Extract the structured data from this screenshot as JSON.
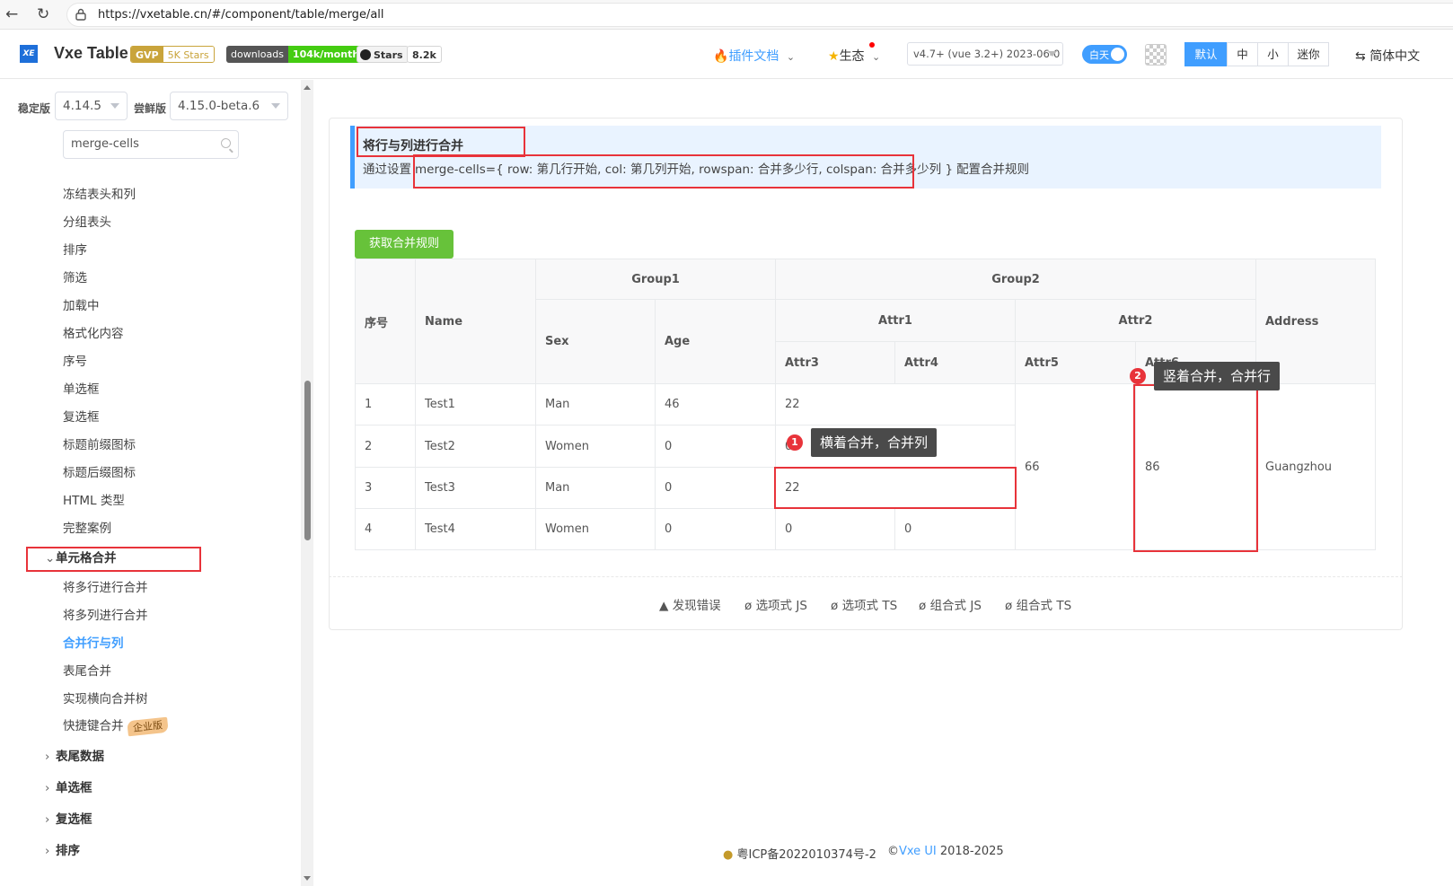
{
  "browser": {
    "url": "https://vxetable.cn/#/component/table/merge/all"
  },
  "header": {
    "logo": "XE",
    "brand": "Vxe Table",
    "badges": {
      "gvp": "GVP",
      "stars5k": "5K Stars",
      "downloads_label": "downloads",
      "downloads_value": "104k/month",
      "gh_stars_label": "Stars",
      "gh_stars_value": "8.2k"
    },
    "plugin_docs": "插件文档",
    "ecosystem": "生态",
    "version": "v4.7+ (vue 3.2+) 2023-06-0",
    "theme_toggle": "白天",
    "sizes": [
      "默认",
      "中",
      "小",
      "迷你"
    ],
    "language": "简体中文",
    "accent": "#409eff"
  },
  "sidebar": {
    "stable_label": "稳定版",
    "stable_value": "4.14.5",
    "beta_label": "尝鲜版",
    "beta_value": "4.15.0-beta.6",
    "search_value": "merge-cells",
    "items_top": [
      "冻结表头和列",
      "分组表头",
      "排序",
      "筛选",
      "加载中",
      "格式化内容",
      "序号",
      "单选框",
      "复选框",
      "标题前缀图标",
      "标题后缀图标",
      "HTML 类型",
      "完整案例"
    ],
    "group_open": "单元格合并",
    "sub_items": [
      "将多行进行合并",
      "将多列进行合并",
      "合并行与列",
      "表尾合并",
      "实现横向合并树",
      "快捷键合并"
    ],
    "enterprise_tag": "企业版",
    "groups_collapsed": [
      "表尾数据",
      "单选框",
      "复选框",
      "排序"
    ]
  },
  "demo": {
    "title": "将行与列进行合并",
    "desc_prefix": "通过设置",
    "desc_code": "merge-cells={ row: 第几行开始, col: 第几列开始, rowspan: 合并多少行, colspan: 合并多少列 }",
    "desc_suffix": "配置合并规则",
    "button": "获取合并规则"
  },
  "table": {
    "headers": {
      "seq": "序号",
      "name": "Name",
      "group1": "Group1",
      "group2": "Group2",
      "sex": "Sex",
      "age": "Age",
      "attr1": "Attr1",
      "attr2": "Attr2",
      "attr3": "Attr3",
      "attr4": "Attr4",
      "attr5": "Attr5",
      "attr6": "Attr6",
      "address": "Address"
    },
    "rows": [
      {
        "seq": "1",
        "name": "Test1",
        "sex": "Man",
        "age": "46",
        "attr3": "22"
      },
      {
        "seq": "2",
        "name": "Test2",
        "sex": "Women",
        "age": "0",
        "attr3": "0"
      },
      {
        "seq": "3",
        "name": "Test3",
        "sex": "Man",
        "age": "0",
        "attr3": "22"
      },
      {
        "seq": "4",
        "name": "Test4",
        "sex": "Women",
        "age": "0",
        "attr3": "0",
        "attr4": "0"
      }
    ],
    "merged": {
      "attr5": "66",
      "attr6": "86",
      "address": "Guangzhou"
    }
  },
  "annotations": {
    "callout1_num": "1",
    "callout1": "横着合并，合并列",
    "callout2_num": "2",
    "callout2": "竖着合并，合并行",
    "highlight_color": "#e8333a"
  },
  "footer_links": [
    "发现错误",
    "选项式 JS",
    "选项式 TS",
    "组合式 JS",
    "组合式 TS"
  ],
  "footer": {
    "icp": "粤ICP备2022010374号-2",
    "copy": "©",
    "vxe": "Vxe UI",
    "years": "2018-2025"
  }
}
